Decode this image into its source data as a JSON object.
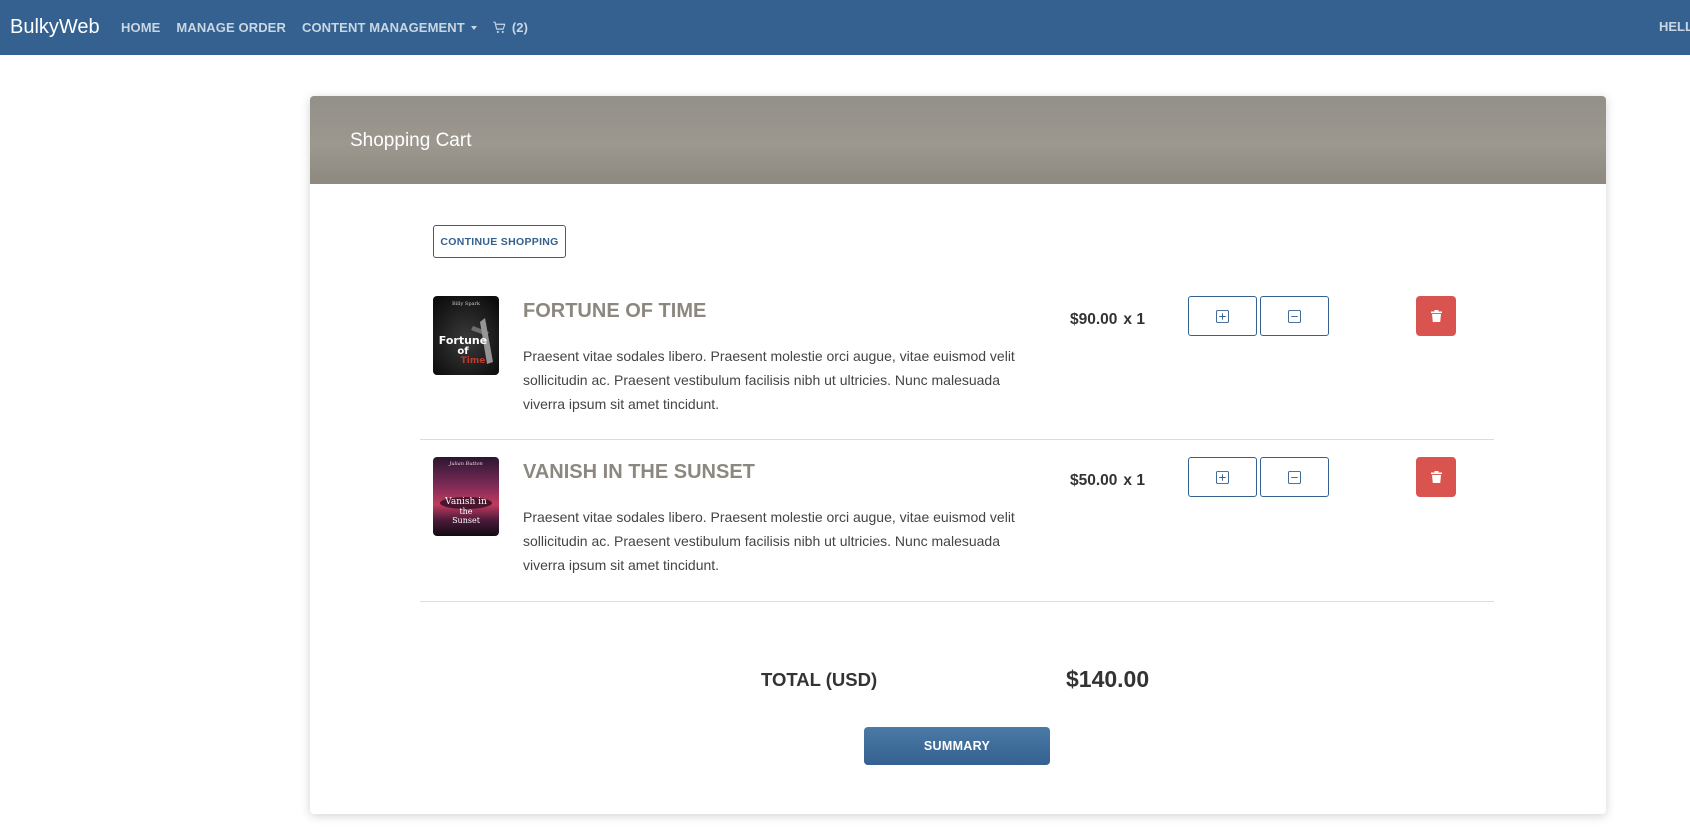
{
  "navbar": {
    "brand": "BulkyWeb",
    "links": {
      "home": "HOME",
      "manage_order": "MANAGE ORDER",
      "content_management": "CONTENT MANAGEMENT",
      "cart_count": "(2)"
    },
    "greeting": "HELL",
    "bg_color": "#34618f"
  },
  "cart": {
    "title": "Shopping Cart",
    "continue_label": "CONTINUE SHOPPING",
    "items": [
      {
        "title": "FORTUNE OF TIME",
        "description": "Praesent vitae sodales libero. Praesent molestie orci augue, vitae euismod velit sollicitudin ac. Praesent vestibulum facilisis nibh ut ultricies. Nunc malesuada viverra ipsum sit amet tincidunt.",
        "price": "$90.00",
        "quantity": "x 1",
        "cover_author": "Billy Spark",
        "cover_text_1": "Fortune",
        "cover_text_2": "of",
        "cover_text_3": "Time"
      },
      {
        "title": "VANISH IN THE SUNSET",
        "description": "Praesent vitae sodales libero. Praesent molestie orci augue, vitae euismod velit sollicitudin ac. Praesent vestibulum facilisis nibh ut ultricies. Nunc malesuada viverra ipsum sit amet tincidunt.",
        "price": "$50.00",
        "quantity": "x 1",
        "cover_author": "Julian Button",
        "cover_text_1": "Vanish in",
        "cover_text_2": "the",
        "cover_text_3": "Sunset"
      }
    ],
    "total_label": "TOTAL (USD)",
    "total_value": "$140.00",
    "summary_label": "SUMMARY"
  },
  "colors": {
    "primary": "#34618f",
    "danger": "#d9534f",
    "header_gray": "#9a968e"
  }
}
